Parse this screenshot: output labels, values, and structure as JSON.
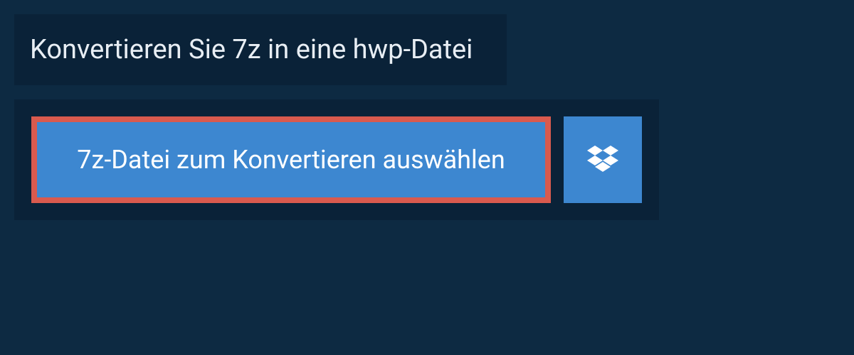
{
  "title": "Konvertieren Sie 7z in eine hwp-Datei",
  "buttons": {
    "select_file_label": "7z-Datei zum Konvertieren auswählen"
  },
  "colors": {
    "page_bg": "#0d2a42",
    "panel_bg": "#0a2238",
    "button_bg": "#3d87d0",
    "highlight_border": "#d95a4e",
    "text_light": "#ffffff"
  },
  "icons": {
    "dropbox": "dropbox-icon"
  }
}
